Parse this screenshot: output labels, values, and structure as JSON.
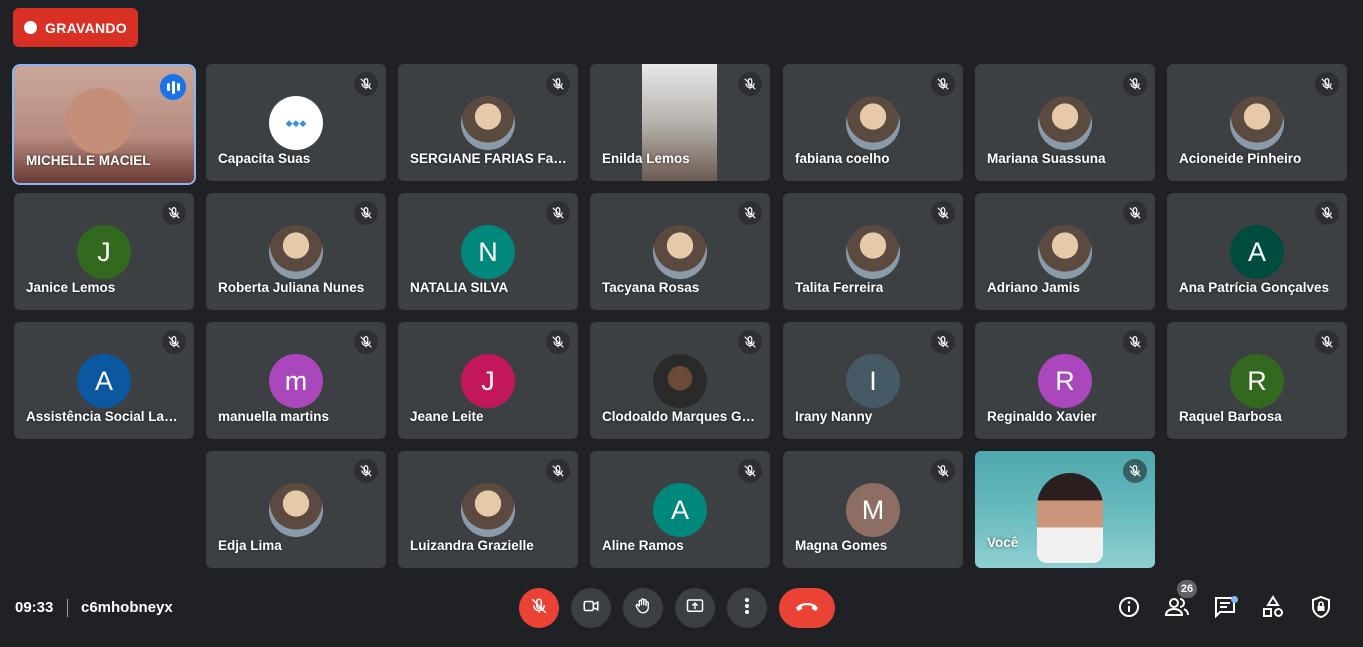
{
  "recording": {
    "label": "GRAVANDO"
  },
  "meeting": {
    "time": "09:33",
    "code": "c6mhobneyx",
    "participants_count": "26"
  },
  "colors": {
    "background": "#202124",
    "tile": "#3c4043",
    "record_red": "#d93025",
    "accent": "#8ab4f8"
  },
  "participants": [
    {
      "name": "MICHELLE MACIEL",
      "kind": "video-main",
      "speaking": true
    },
    {
      "name": "Capacita Suas",
      "kind": "photo",
      "muted": true
    },
    {
      "name": "SERGIANE FARIAS Far…",
      "kind": "photo",
      "muted": true
    },
    {
      "name": "Enilda Lemos",
      "kind": "video",
      "muted": true
    },
    {
      "name": "fabiana coelho",
      "kind": "photo",
      "muted": true
    },
    {
      "name": "Mariana Suassuna",
      "kind": "photo",
      "muted": true
    },
    {
      "name": "Acioneide Pinheiro",
      "kind": "photo",
      "muted": true
    },
    {
      "name": "Janice Lemos",
      "initial": "J",
      "color": "#33691e",
      "muted": true
    },
    {
      "name": "Roberta Juliana Nunes",
      "kind": "photo",
      "muted": true
    },
    {
      "name": "NATALIA SILVA",
      "initial": "N",
      "color": "#00897b",
      "muted": true
    },
    {
      "name": "Tacyana Rosas",
      "kind": "photo",
      "muted": true
    },
    {
      "name": "Talita Ferreira",
      "kind": "photo",
      "muted": true
    },
    {
      "name": "Adriano Jamis",
      "kind": "photo",
      "muted": true
    },
    {
      "name": "Ana Patrícia Gonçalves",
      "initial": "A",
      "color": "#004d40",
      "muted": true
    },
    {
      "name": "Assistência Social Lag…",
      "initial": "A",
      "color": "#0b57a0",
      "muted": true
    },
    {
      "name": "manuella martins",
      "initial": "m",
      "color": "#ab47bc",
      "muted": true
    },
    {
      "name": "Jeane Leite",
      "initial": "J",
      "color": "#c2185b",
      "muted": true
    },
    {
      "name": "Clodoaldo Marques G…",
      "kind": "photo",
      "muted": true
    },
    {
      "name": "Irany Nanny",
      "initial": "I",
      "color": "#455a64",
      "muted": true
    },
    {
      "name": "Reginaldo Xavier",
      "initial": "R",
      "color": "#ab47bc",
      "muted": true
    },
    {
      "name": "Raquel Barbosa",
      "initial": "R",
      "color": "#33691e",
      "muted": true
    },
    {
      "name": "Edja Lima",
      "kind": "photo",
      "muted": true
    },
    {
      "name": "Luizandra Grazielle",
      "kind": "photo",
      "muted": true
    },
    {
      "name": "Aline Ramos",
      "initial": "A",
      "color": "#00897b",
      "muted": true
    },
    {
      "name": "Magna Gomes",
      "initial": "M",
      "color": "#8d6e63",
      "muted": true
    },
    {
      "name": "Você",
      "kind": "video-self",
      "muted": true
    }
  ],
  "controls": [
    {
      "name": "mic-off-icon"
    },
    {
      "name": "camera-icon"
    },
    {
      "name": "raise-hand-icon"
    },
    {
      "name": "present-screen-icon"
    },
    {
      "name": "more-options-icon"
    },
    {
      "name": "hang-up-icon"
    }
  ],
  "right_icons": [
    {
      "name": "info-icon"
    },
    {
      "name": "people-icon"
    },
    {
      "name": "chat-icon"
    },
    {
      "name": "activities-icon"
    },
    {
      "name": "host-controls-icon"
    }
  ]
}
